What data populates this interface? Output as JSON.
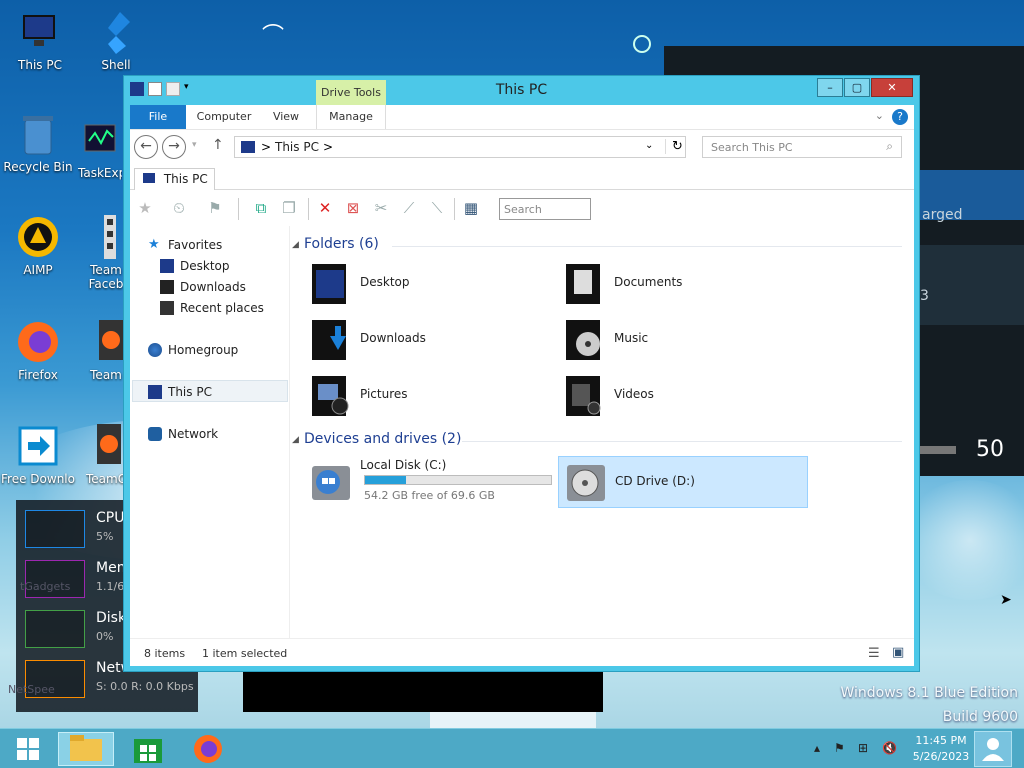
{
  "desktop": {
    "icons": [
      {
        "label": "This PC"
      },
      {
        "label": "Shell"
      },
      {
        "label": "Recycle Bin"
      },
      {
        "label": "TaskExp"
      },
      {
        "label": "AIMP"
      },
      {
        "label": "Team Faceb"
      },
      {
        "label": "Firefox"
      },
      {
        "label": "Team"
      },
      {
        "label": "Free Downlo"
      },
      {
        "label": "TeamO"
      }
    ],
    "right_panel": {
      "charged_text": "arged",
      "num_3": "3",
      "volume": "50"
    },
    "watermark": {
      "line1": "Windows 8.1 Blue Edition",
      "line2": "Build 9600"
    }
  },
  "gadget": {
    "rows": [
      {
        "title": "CPU",
        "value": "5%",
        "color": "#1e88e5"
      },
      {
        "title": "Mem",
        "value": "1.1/6",
        "color": "#9c27b0"
      },
      {
        "title": "Disk",
        "value": "0%",
        "color": "#43a047"
      },
      {
        "title": "Netw",
        "value": "S: 0.0 R: 0.0 Kbps",
        "color": "#fb8c00"
      }
    ],
    "overlay": {
      "gadgets": "tGadgets",
      "netspeed": "NetSpee"
    }
  },
  "window": {
    "title": "This PC",
    "context_tab_group": "Drive Tools",
    "ribbon_tabs": {
      "file": "File",
      "computer": "Computer",
      "view": "View",
      "manage": "Manage"
    },
    "address": {
      "crumb": "This PC",
      "sep": ">"
    },
    "search": {
      "placeholder": "Search This PC"
    },
    "tab": {
      "label": "This PC"
    },
    "toolbar_search": {
      "placeholder": "Search"
    },
    "nav": {
      "favorites": "Favorites",
      "desktop": "Desktop",
      "downloads": "Downloads",
      "recent": "Recent places",
      "homegroup": "Homegroup",
      "thispc": "This PC",
      "network": "Network"
    },
    "groups": {
      "folders": "Folders (6)",
      "drives": "Devices and drives (2)"
    },
    "folders": [
      {
        "name": "Desktop"
      },
      {
        "name": "Documents"
      },
      {
        "name": "Downloads"
      },
      {
        "name": "Music"
      },
      {
        "name": "Pictures"
      },
      {
        "name": "Videos"
      }
    ],
    "drives": {
      "c": {
        "name": "Local Disk (C:)",
        "free": "54.2 GB free of 69.6 GB",
        "used_fraction": 0.22
      },
      "d": {
        "name": "CD Drive (D:)"
      }
    },
    "status": {
      "items": "8 items",
      "selected": "1 item selected"
    }
  },
  "taskbar": {
    "clock": {
      "time": "11:45 PM",
      "date": "5/26/2023"
    }
  }
}
